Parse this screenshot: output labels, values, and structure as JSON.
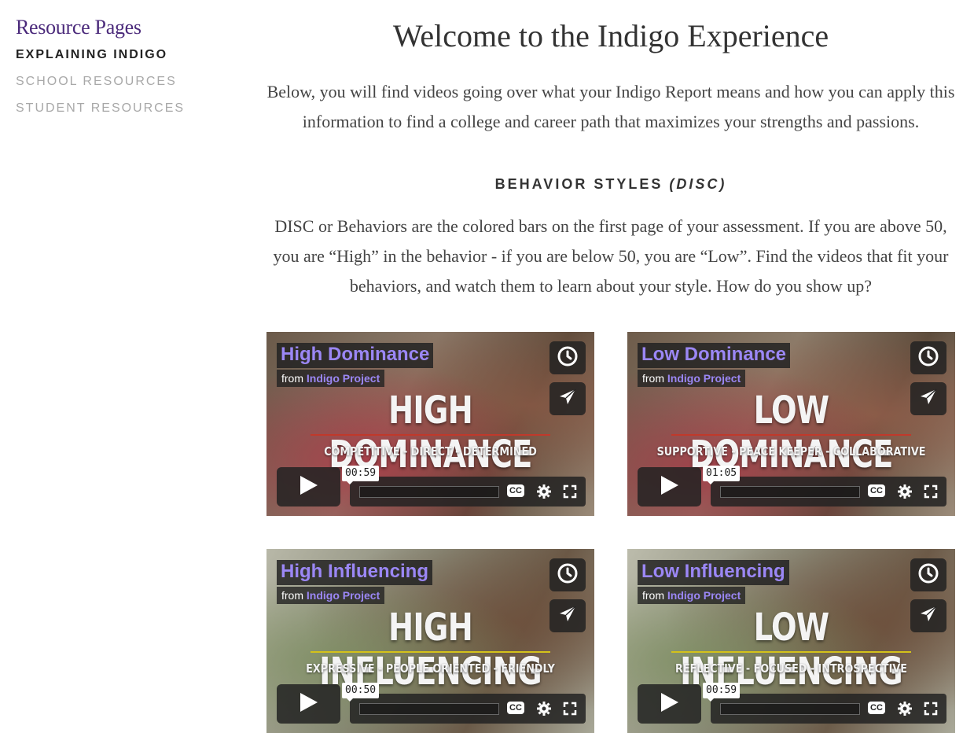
{
  "sidebar": {
    "title": "Resource Pages",
    "items": [
      {
        "label": "EXPLAINING INDIGO",
        "active": true
      },
      {
        "label": "SCHOOL RESOURCES",
        "active": false
      },
      {
        "label": "STUDENT RESOURCES",
        "active": false
      }
    ]
  },
  "main": {
    "title": "Welcome to the Indigo Experience",
    "intro": "Below, you will find videos going over what your Indigo Report means and how you can apply this information to find a college and career path that maximizes your strengths and passions.",
    "section_heading": "BEHAVIOR STYLES",
    "section_heading_em": "(DISC)",
    "disc_text": "DISC or Behaviors are the colored bars on the first page of your assessment. If you are above 50, you are “High” in the behavior - if you are below 50, you are “Low”.  Find the videos that fit your behaviors, and watch them to learn about your style. How do you show up?"
  },
  "videos": [
    {
      "title": "High Dominance",
      "from": "from",
      "project": "Indigo Project",
      "big_text": "HIGH DOMINANCE",
      "traits": "COMPETITIVE -  DIRECT - DETERMINED",
      "time": "00:59",
      "cc": "CC",
      "line_color": "#c0392b"
    },
    {
      "title": "Low Dominance",
      "from": "from",
      "project": "Indigo Project",
      "big_text": "LOW DOMINANCE",
      "traits": "SUPPORTIVE - PEACE KEEPER - COLLABORATIVE",
      "time": "01:05",
      "cc": "CC",
      "line_color": "#c0392b"
    },
    {
      "title": "High Influencing",
      "from": "from",
      "project": "Indigo Project",
      "big_text": "HIGH INFLUENCING",
      "traits": "EXPRESSIVE - PEOPLE ORIENTED - FRIENDLY",
      "time": "00:50",
      "cc": "CC",
      "line_color": "#d4c21a"
    },
    {
      "title": "Low Influencing",
      "from": "from",
      "project": "Indigo Project",
      "big_text": "LOW INFLUENCING",
      "traits": "REFLECTIVE - FOCUSED - INTROSPECTIVE",
      "time": "00:59",
      "cc": "CC",
      "line_color": "#d4c21a"
    }
  ]
}
